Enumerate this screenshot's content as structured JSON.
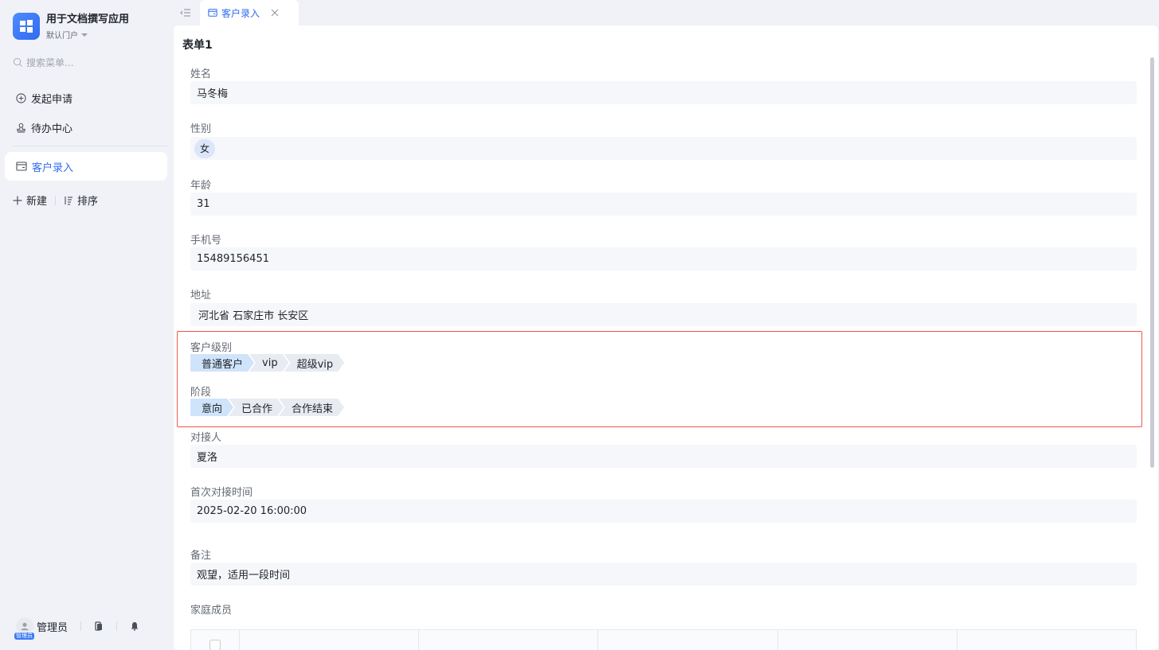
{
  "app": {
    "title": "用于文档撰写应用",
    "portal": "默认门户"
  },
  "sidebar": {
    "search_placeholder": "搜索菜单...",
    "items": [
      {
        "label": "发起申请",
        "icon": "plus-circle-icon"
      },
      {
        "label": "待办中心",
        "icon": "stamp-icon"
      }
    ],
    "active_item": {
      "label": "客户录入",
      "icon": "form-icon"
    },
    "actions": {
      "new_label": "新建",
      "sort_label": "排序"
    },
    "footer": {
      "user_name": "管理员",
      "avatar_tag": "管理员"
    }
  },
  "tabs": [
    {
      "label": "客户录入",
      "active": true
    }
  ],
  "form": {
    "title": "表单1",
    "fields": {
      "name": {
        "label": "姓名",
        "value": "马冬梅"
      },
      "gender": {
        "label": "性别",
        "value": "女"
      },
      "age": {
        "label": "年龄",
        "value": "31"
      },
      "phone": {
        "label": "手机号",
        "value": "15489156451"
      },
      "address": {
        "label": "地址",
        "value": "河北省 石家庄市 长安区"
      },
      "contact": {
        "label": "对接人",
        "value": "夏洛"
      },
      "first_contact_time": {
        "label": "首次对接时间",
        "value": "2025-02-20 16:00:00"
      },
      "remark": {
        "label": "备注",
        "value": "观望，适用一段时间"
      },
      "family": {
        "label": "家庭成员"
      }
    },
    "customer_level": {
      "label": "客户级别",
      "steps": [
        "普通客户",
        "vip",
        "超级vip"
      ],
      "active_index": 0
    },
    "stage": {
      "label": "阶段",
      "steps": [
        "意向",
        "已合作",
        "合作结束"
      ],
      "active_index": 0
    }
  },
  "colors": {
    "accent": "#2f6bf0",
    "highlight_border": "#f0564a",
    "step_active": "#cfe3fb",
    "step_inactive": "#e8ebf1"
  }
}
